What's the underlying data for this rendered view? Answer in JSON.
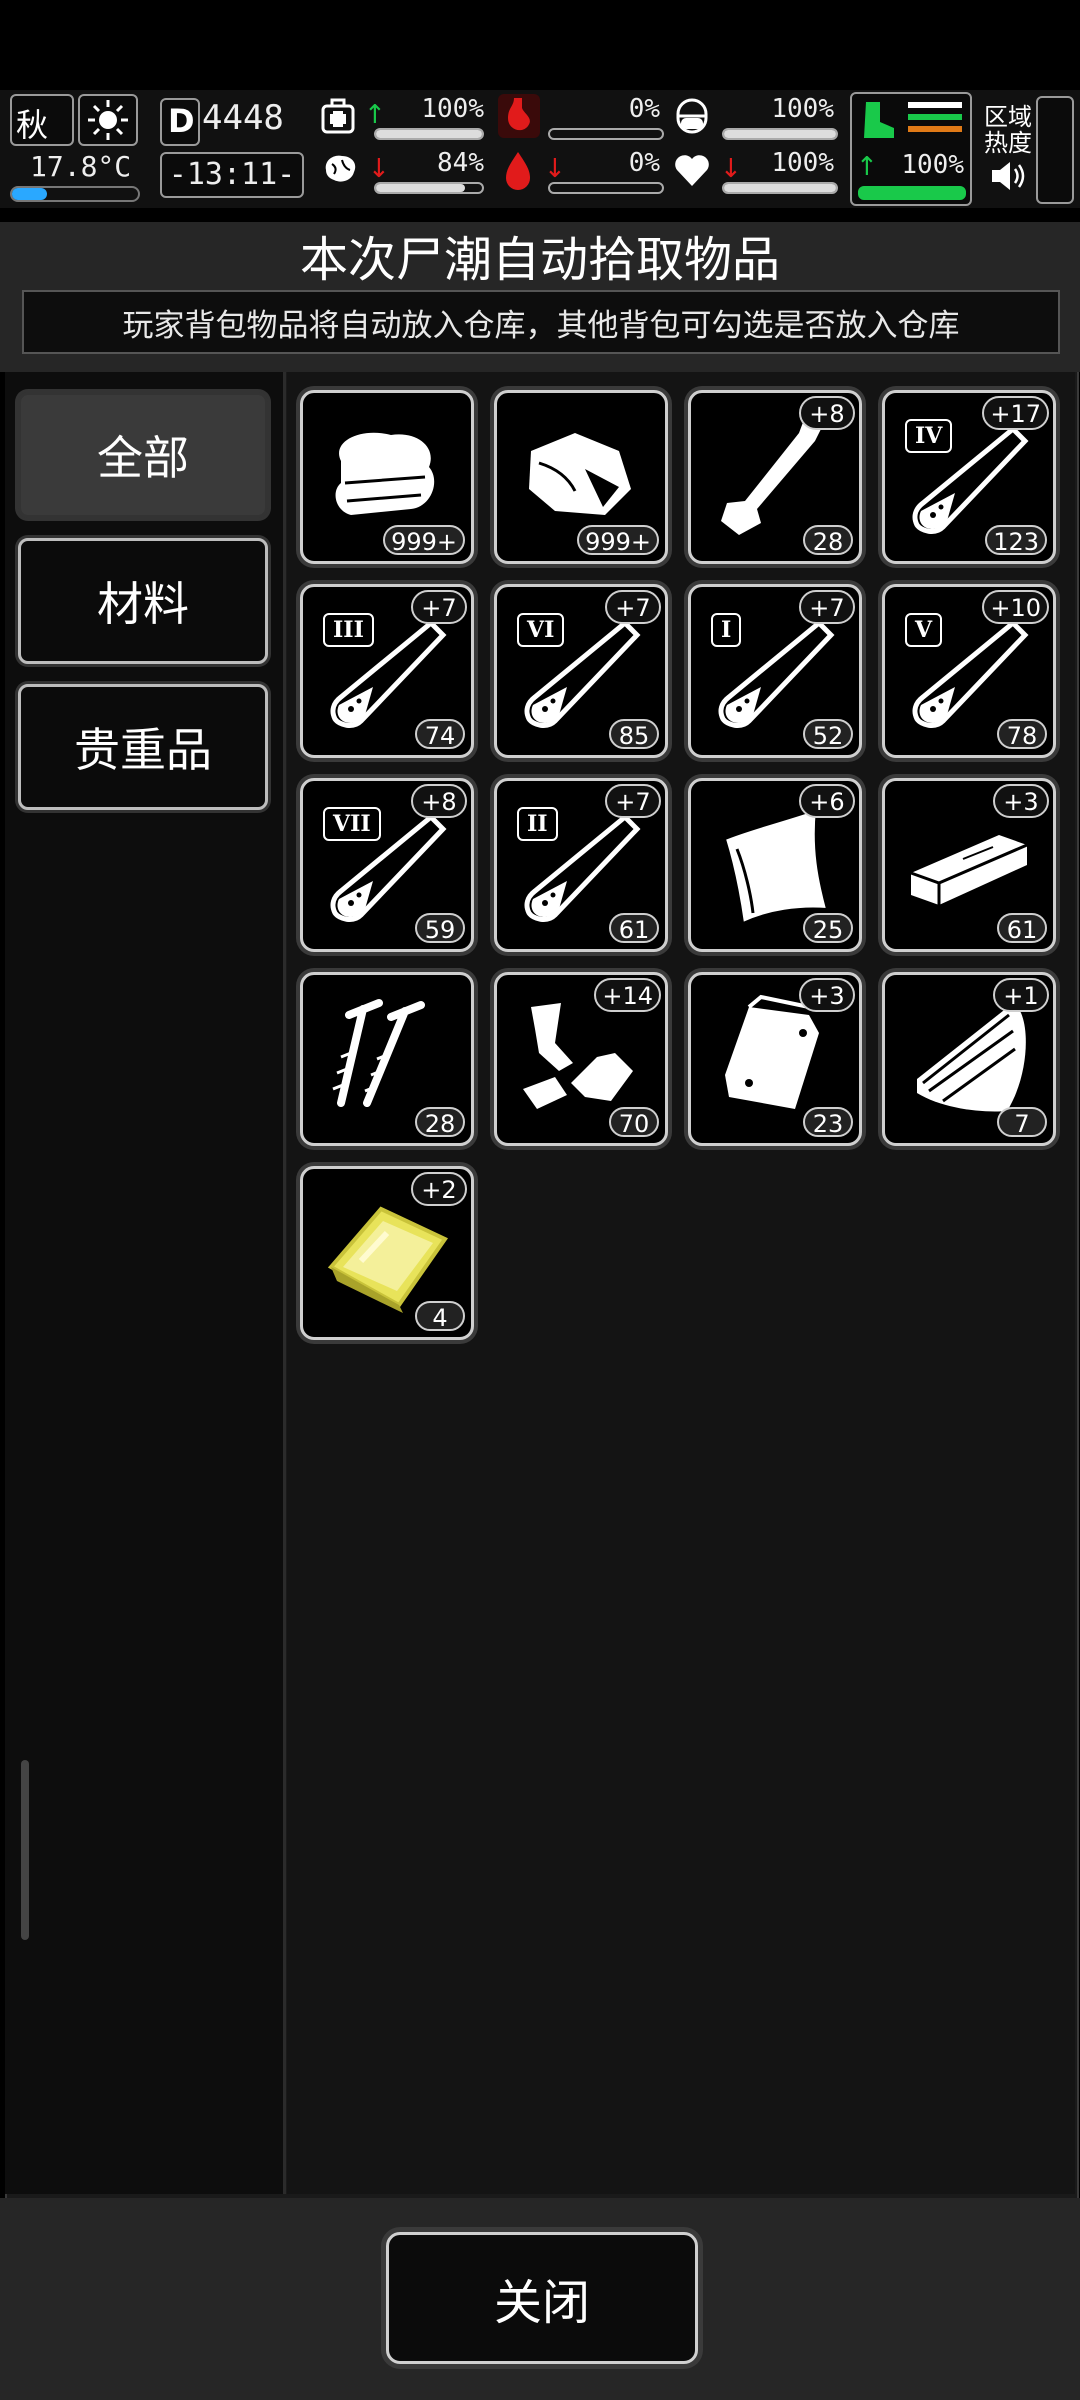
{
  "hud": {
    "season": "秋",
    "day": "4448",
    "temperature": "17.8°C",
    "time": "-13:11-",
    "stats": [
      {
        "name": "health",
        "value": "100%",
        "trend": "up",
        "level": 1.0
      },
      {
        "name": "hunger",
        "value": "0%",
        "trend": "none",
        "level": 0.0
      },
      {
        "name": "pill",
        "value": "100%",
        "trend": "none",
        "level": 1.0
      },
      {
        "name": "mind",
        "value": "84%",
        "trend": "down",
        "level": 0.84
      },
      {
        "name": "thirst",
        "value": "0%",
        "trend": "down",
        "level": 0.0
      },
      {
        "name": "heart",
        "value": "100%",
        "trend": "down",
        "level": 1.0
      },
      {
        "name": "stamina",
        "value": "100%",
        "trend": "up",
        "level": 1.0
      }
    ],
    "zone_heat_label_1": "区域",
    "zone_heat_label_2": "热度",
    "colors": {
      "up": "#19c94a",
      "down": "#e11b1b",
      "stamina": "#19c94a",
      "orange": "#e07a17"
    }
  },
  "dialog": {
    "title": "本次尸潮自动拾取物品",
    "subtitle": "玩家背包物品将自动放入仓库，其他背包可勾选是否放入仓库",
    "close_label": "关闭"
  },
  "tabs": [
    {
      "label": "全部",
      "active": true
    },
    {
      "label": "材料",
      "active": false
    },
    {
      "label": "贵重品",
      "active": false
    }
  ],
  "items": [
    {
      "icon": "cloth-icon",
      "count": "999+",
      "plus": "",
      "roman": ""
    },
    {
      "icon": "meat-icon",
      "count": "999+",
      "plus": "",
      "roman": ""
    },
    {
      "icon": "bone-icon",
      "count": "28",
      "plus": "+8",
      "roman": ""
    },
    {
      "icon": "test-tube-icon",
      "count": "123",
      "plus": "+17",
      "roman": "IV"
    },
    {
      "icon": "test-tube-icon",
      "count": "74",
      "plus": "+7",
      "roman": "III"
    },
    {
      "icon": "test-tube-icon",
      "count": "85",
      "plus": "+7",
      "roman": "VI"
    },
    {
      "icon": "test-tube-icon",
      "count": "52",
      "plus": "+7",
      "roman": "I"
    },
    {
      "icon": "test-tube-icon",
      "count": "78",
      "plus": "+10",
      "roman": "V"
    },
    {
      "icon": "test-tube-icon",
      "count": "59",
      "plus": "+8",
      "roman": "VII"
    },
    {
      "icon": "test-tube-icon",
      "count": "61",
      "plus": "+7",
      "roman": "II"
    },
    {
      "icon": "leather-icon",
      "count": "25",
      "plus": "+6",
      "roman": ""
    },
    {
      "icon": "plank-icon",
      "count": "61",
      "plus": "+3",
      "roman": ""
    },
    {
      "icon": "nails-icon",
      "count": "28",
      "plus": "",
      "roman": ""
    },
    {
      "icon": "scrap-icon",
      "count": "70",
      "plus": "+14",
      "roman": ""
    },
    {
      "icon": "plastic-bag-icon",
      "count": "23",
      "plus": "+3",
      "roman": ""
    },
    {
      "icon": "wood-log-icon",
      "count": "7",
      "plus": "+1",
      "roman": ""
    },
    {
      "icon": "gold-bar-icon",
      "count": "4",
      "plus": "+2",
      "roman": ""
    }
  ]
}
